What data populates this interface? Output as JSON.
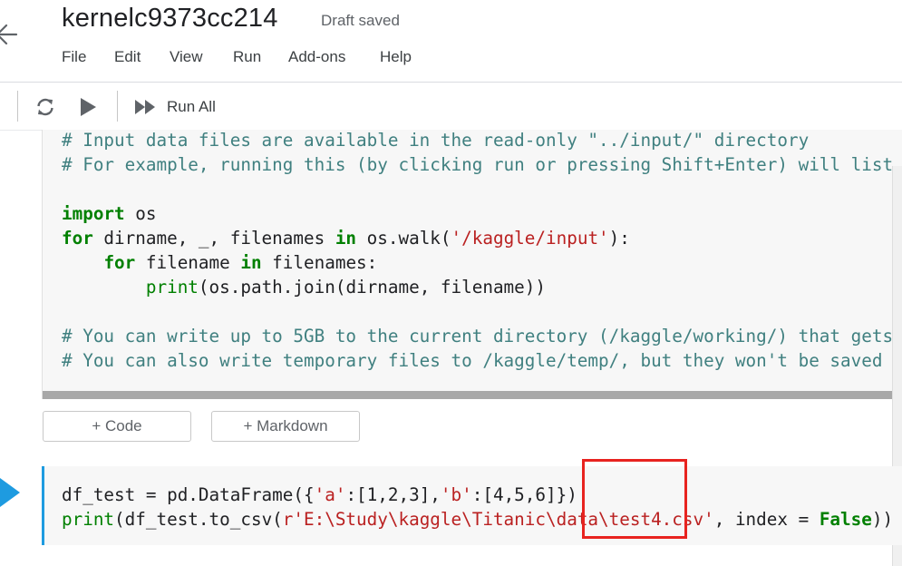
{
  "header": {
    "title": "kernelc9373cc214",
    "status": "Draft saved",
    "menu": [
      "File",
      "Edit",
      "View",
      "Run",
      "Add-ons",
      "Help"
    ]
  },
  "toolbar": {
    "run_all_label": "Run All"
  },
  "cell1": {
    "lines": [
      [
        {
          "t": "# Input data files are available in the read-only \"../input/\" directory",
          "c": "cm"
        }
      ],
      [
        {
          "t": "# For example, running this (by clicking run or pressing Shift+Enter) will list",
          "c": "cm"
        }
      ],
      [
        {
          "t": "",
          "c": "tx"
        }
      ],
      [
        {
          "t": "import",
          "c": "kw"
        },
        {
          "t": " os",
          "c": "tx"
        }
      ],
      [
        {
          "t": "for",
          "c": "kw"
        },
        {
          "t": " dirname, _, filenames ",
          "c": "tx"
        },
        {
          "t": "in",
          "c": "kw"
        },
        {
          "t": " os.walk(",
          "c": "tx"
        },
        {
          "t": "'/kaggle/input'",
          "c": "st"
        },
        {
          "t": "):",
          "c": "tx"
        }
      ],
      [
        {
          "t": "    ",
          "c": "tx"
        },
        {
          "t": "for",
          "c": "kw"
        },
        {
          "t": " filename ",
          "c": "tx"
        },
        {
          "t": "in",
          "c": "kw"
        },
        {
          "t": " filenames:",
          "c": "tx"
        }
      ],
      [
        {
          "t": "        ",
          "c": "tx"
        },
        {
          "t": "print",
          "c": "bi"
        },
        {
          "t": "(os.path.join(dirname, filename))",
          "c": "tx"
        }
      ],
      [
        {
          "t": "",
          "c": "tx"
        }
      ],
      [
        {
          "t": "# You can write up to 5GB to the current directory (/kaggle/working/) that gets",
          "c": "cm"
        }
      ],
      [
        {
          "t": "# You can also write temporary files to /kaggle/temp/, but they won't be saved o",
          "c": "cm"
        }
      ]
    ]
  },
  "add_buttons": {
    "code": "+ Code",
    "markdown": "+ Markdown"
  },
  "cell2": {
    "lines": [
      [
        {
          "t": "df_test = pd.DataFrame({",
          "c": "tx"
        },
        {
          "t": "'a'",
          "c": "st"
        },
        {
          "t": ":[1,2,3],",
          "c": "tx"
        },
        {
          "t": "'b'",
          "c": "st"
        },
        {
          "t": ":[4,5,6]})",
          "c": "tx"
        }
      ],
      [
        {
          "t": "print",
          "c": "bi"
        },
        {
          "t": "(df_test.to_csv(",
          "c": "tx"
        },
        {
          "t": "r'E:\\Study\\kaggle\\Titanic\\data\\test4.csv'",
          "c": "st"
        },
        {
          "t": ", index = ",
          "c": "tx"
        },
        {
          "t": "False",
          "c": "kw"
        },
        {
          "t": "))",
          "c": "tx"
        }
      ]
    ]
  },
  "colors": {
    "accent": "#1e9be0",
    "highlight": "#e8231f",
    "comment": "#408080",
    "keyword": "#008000",
    "string": "#ba2121"
  }
}
